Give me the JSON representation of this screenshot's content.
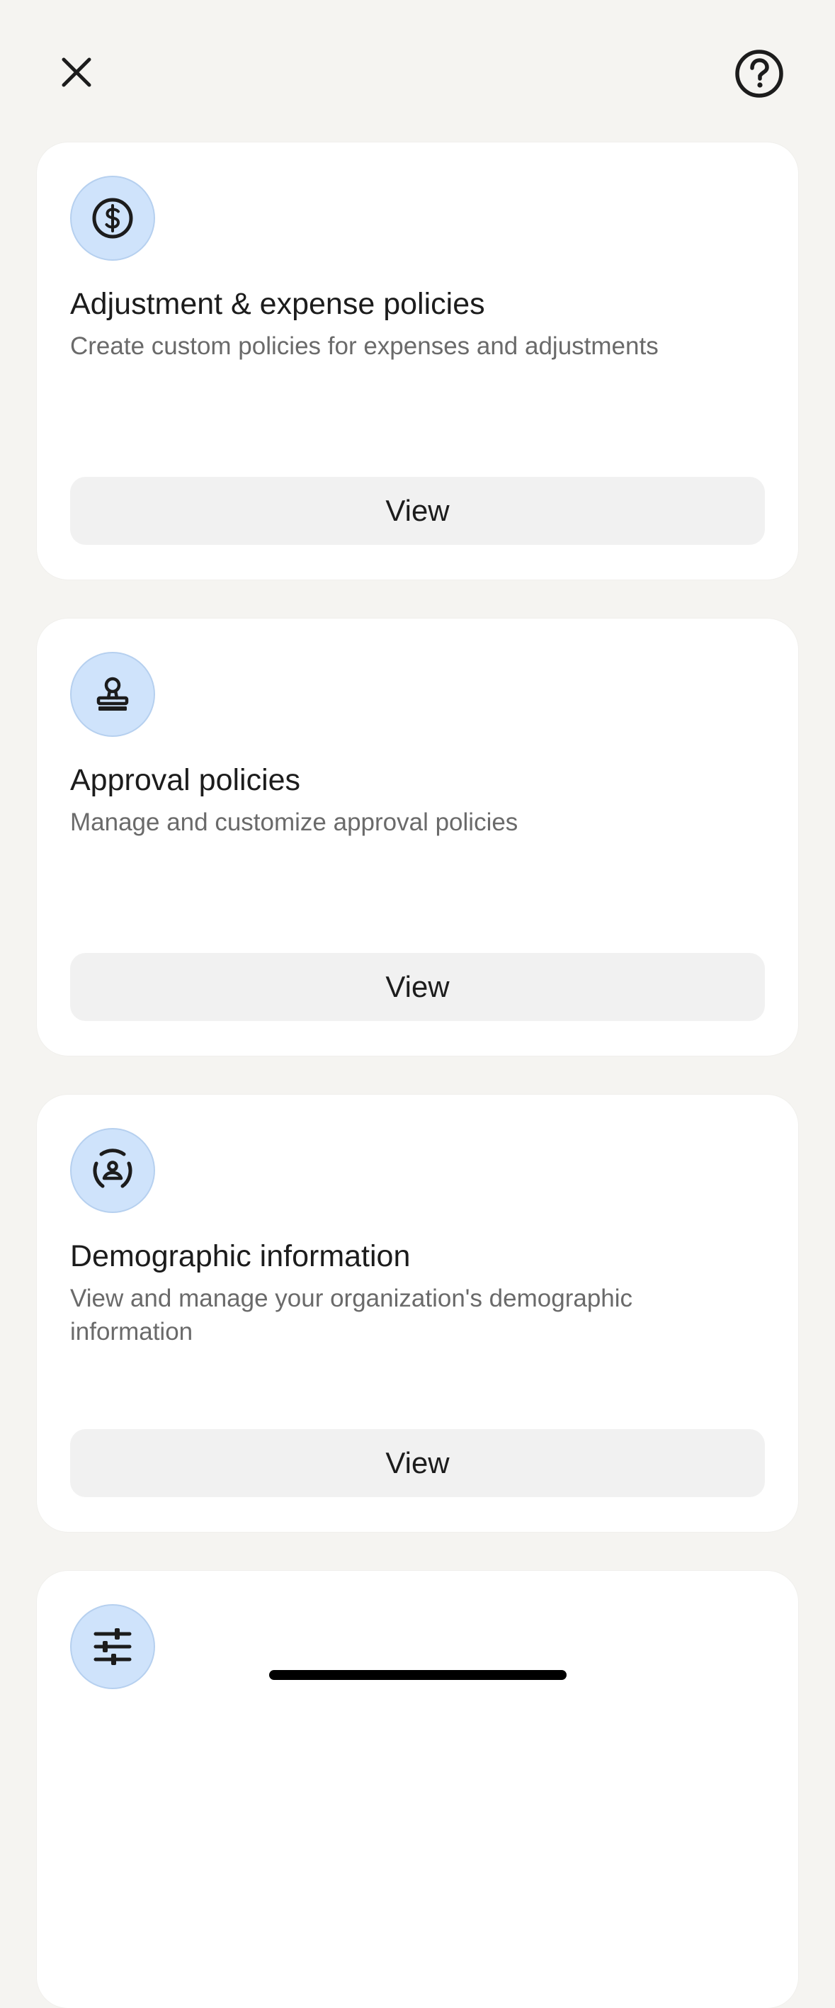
{
  "header": {
    "close_icon": "close-icon",
    "help_icon": "help-icon"
  },
  "cards": [
    {
      "icon": "dollar-circle-icon",
      "title": "Adjustment & expense policies",
      "description": "Create custom policies for expenses and adjustments",
      "button_label": "View"
    },
    {
      "icon": "stamp-icon",
      "title": "Approval policies",
      "description": "Manage and customize approval policies",
      "button_label": "View"
    },
    {
      "icon": "person-scan-icon",
      "title": "Demographic information",
      "description": "View and manage your organization's demographic information",
      "button_label": "View"
    },
    {
      "icon": "sliders-icon"
    }
  ],
  "colors": {
    "background": "#f5f4f1",
    "card": "#ffffff",
    "icon_bg": "#cfe3fb",
    "button_bg": "#f1f1f1"
  }
}
